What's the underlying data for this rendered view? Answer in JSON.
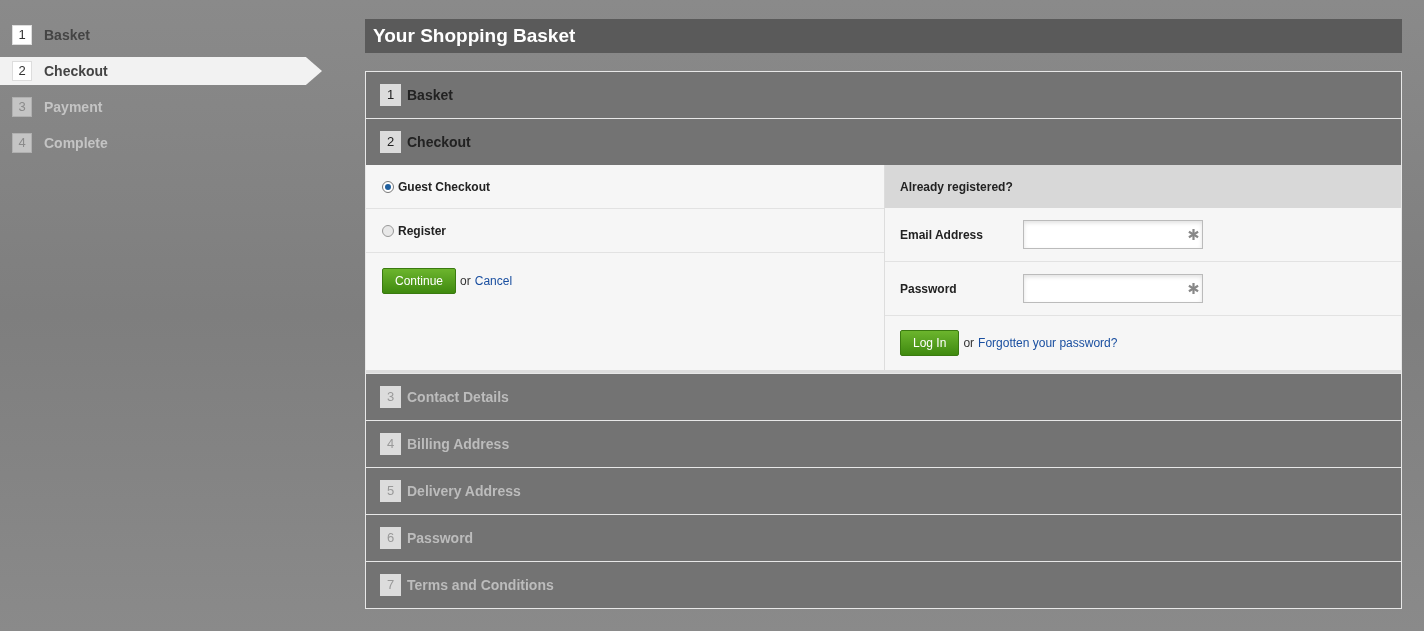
{
  "steps": [
    {
      "number": "1",
      "label": "Basket",
      "selected": false,
      "enabled": true
    },
    {
      "number": "2",
      "label": "Checkout",
      "selected": true,
      "enabled": true
    },
    {
      "number": "3",
      "label": "Payment",
      "selected": false,
      "enabled": false
    },
    {
      "number": "4",
      "label": "Complete",
      "selected": false,
      "enabled": false
    }
  ],
  "page_title": "Your Shopping Basket",
  "sections": [
    {
      "number": "1",
      "title": "Basket",
      "enabled": true,
      "expanded": false
    },
    {
      "number": "2",
      "title": "Checkout",
      "enabled": true,
      "expanded": true
    },
    {
      "number": "3",
      "title": "Contact Details",
      "enabled": false,
      "expanded": false
    },
    {
      "number": "4",
      "title": "Billing Address",
      "enabled": false,
      "expanded": false
    },
    {
      "number": "5",
      "title": "Delivery Address",
      "enabled": false,
      "expanded": false
    },
    {
      "number": "6",
      "title": "Password",
      "enabled": false,
      "expanded": false
    },
    {
      "number": "7",
      "title": "Terms and Conditions",
      "enabled": false,
      "expanded": false
    }
  ],
  "checkout_options": [
    {
      "label": "Guest Checkout",
      "selected": true
    },
    {
      "label": "Register",
      "selected": false
    }
  ],
  "continue_button": "Continue",
  "or_1": "or",
  "cancel_link": "Cancel",
  "login": {
    "heading": "Already registered?",
    "fields": [
      {
        "label": "Email Address",
        "required": true
      },
      {
        "label": "Password",
        "required": true
      }
    ],
    "login_button": "Log In",
    "or": "or",
    "forgot_link": "Forgotten your password?"
  }
}
